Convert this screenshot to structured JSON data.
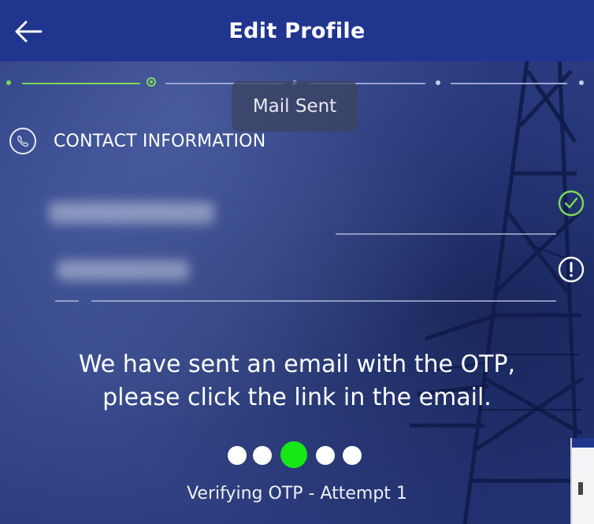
{
  "header": {
    "title": "Edit Profile",
    "back_icon": "arrow-left-icon"
  },
  "stepper": {
    "tooltip": "Mail Sent",
    "completed_color": "#7ed957",
    "current_step": 2
  },
  "contact": {
    "section_title": "CONTACT INFORMATION",
    "section_icon": "phone-icon",
    "field1_status_icon": "check-circle-icon",
    "field2_status_icon": "exclamation-circle-icon"
  },
  "message": {
    "line1": "We have sent an email with the OTP,",
    "line2": "please click the link in the email."
  },
  "loader": {
    "active_color": "#17e617",
    "active_index": 2,
    "dot_count": 5
  },
  "status": {
    "verify_text": "Verifying OTP - Attempt 1"
  },
  "colors": {
    "header_bg": "#20368e",
    "accent_green": "#7ed957"
  }
}
